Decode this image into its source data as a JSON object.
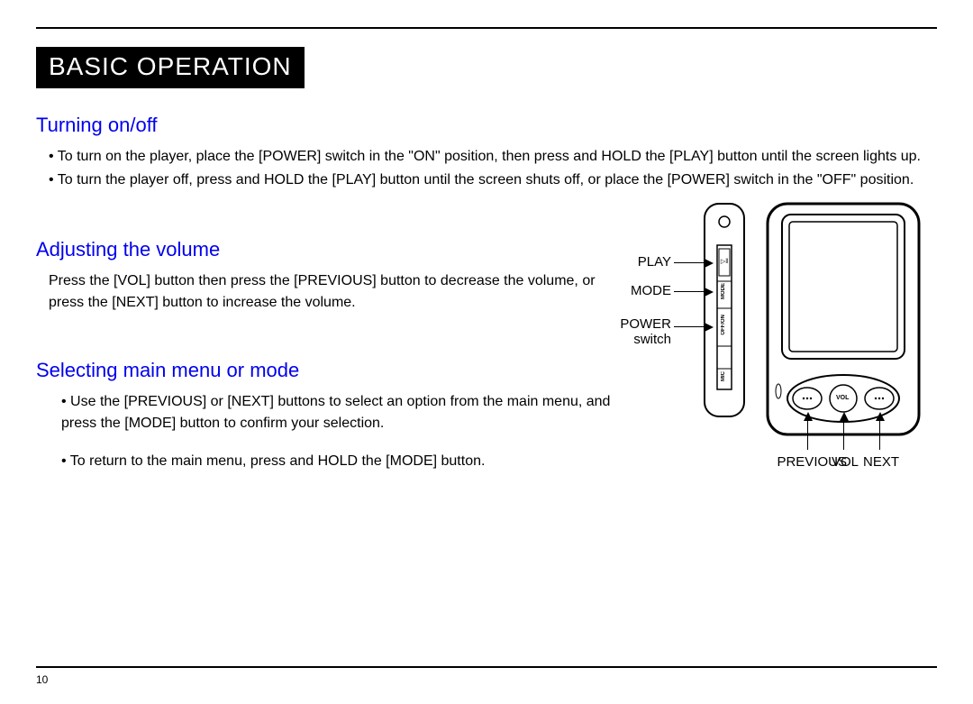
{
  "page": {
    "title": "BASIC OPERATION",
    "number": "10"
  },
  "sections": {
    "turning": {
      "heading": "Turning on/off",
      "b1": "To turn on the player, place the [POWER] switch in the \"ON\" position, then press and HOLD the [PLAY] button until the screen lights up.",
      "b2": "To turn the player off, press and HOLD the [PLAY] button until the screen shuts off, or place the [POWER] switch in the \"OFF\" position."
    },
    "volume": {
      "heading": "Adjusting the volume",
      "p1": "Press the [VOL] button then press the [PREVIOUS] button to decrease the volume, or press the [NEXT] button to increase the volume."
    },
    "mode": {
      "heading": "Selecting main menu or mode",
      "b1": "Use the [PREVIOUS] or [NEXT] buttons to select an option from the main menu, and press the [MODE] button to confirm your selection.",
      "b2": "To return to the main menu, press and HOLD the [MODE] button."
    }
  },
  "diagram": {
    "play": "PLAY",
    "mode": "MODE",
    "power": "POWER",
    "switch": "switch",
    "previous": "PREVIOUS",
    "vol": "VOL",
    "next": "NEXT",
    "vol_btn": "VOL",
    "side_mode": "MODE",
    "side_offon": "OFF/ON",
    "side_mic": "MIC"
  }
}
